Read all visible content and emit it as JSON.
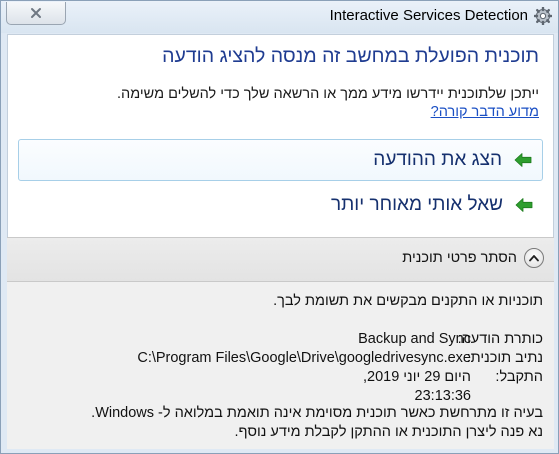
{
  "window": {
    "title": "Interactive Services Detection",
    "app_icon": "gear-icon",
    "close_icon": "close-icon"
  },
  "main": {
    "headline": "תוכנית הפועלת במחשב זה מנסה להציג הודעה",
    "description": "ייתכן שלתוכנית יידרשו מידע ממך או הרשאה שלך כדי להשלים משימה.",
    "more_info_link": "מדוע הדבר קורה?",
    "commands": [
      {
        "label": "הצג את ההודעה",
        "icon": "green-arrow-icon"
      },
      {
        "label": "שאל אותי מאוחר יותר",
        "icon": "green-arrow-icon"
      }
    ]
  },
  "details_toggle": {
    "label": "הסתר פרטי תוכנית",
    "icon": "chevron-up-icon"
  },
  "details": {
    "intro": "תוכניות או התקנים מבקשים את תשומת לבך.",
    "rows": [
      {
        "key": "כותרת הודעה:",
        "value": "Backup and Sync"
      },
      {
        "key": "נתיב תוכנית:",
        "value": "C:\\Program Files\\Google\\Drive\\googledrivesync.exe"
      },
      {
        "key": "התקבל:",
        "value": "היום 29 יוני 2019,",
        "value2": "23:13:36"
      }
    ],
    "note_line1": "בעיה זו מתרחשת כאשר תוכנית מסוימת אינה תואמת במלואה ל- Windows.",
    "note_line2": "נא פנה ליצרן התוכנית או ההתקן לקבלת מידע נוסף."
  },
  "colors": {
    "headline": "#1f3c91",
    "link": "#1a4fc4",
    "arrow": "#2e9e2e",
    "frame": "#dfe9f4"
  }
}
